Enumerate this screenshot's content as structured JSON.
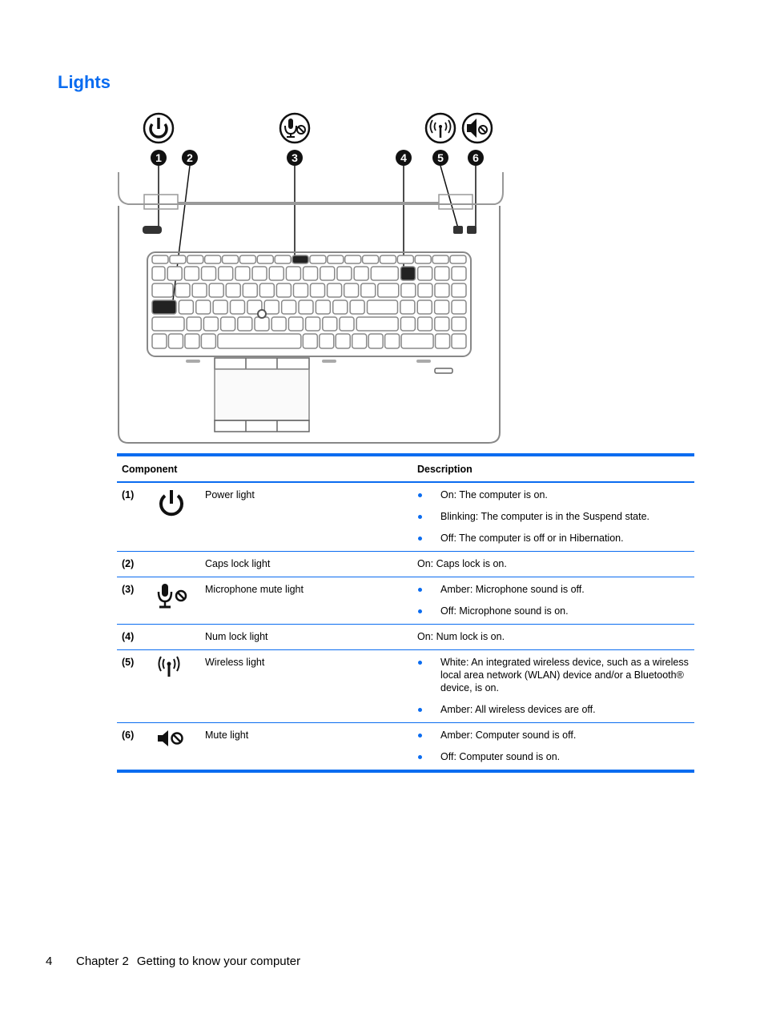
{
  "page": {
    "title": "Lights",
    "footer": {
      "page_number": "4",
      "chapter": "Chapter 2",
      "chapter_title": "Getting to know your computer"
    }
  },
  "figure": {
    "callouts": [
      {
        "number": "1",
        "icon": "power-icon"
      },
      {
        "number": "2",
        "icon": ""
      },
      {
        "number": "3",
        "icon": "microphone-mute-icon"
      },
      {
        "number": "4",
        "icon": ""
      },
      {
        "number": "5",
        "icon": "wireless-icon"
      },
      {
        "number": "6",
        "icon": "mute-icon"
      }
    ]
  },
  "table": {
    "headers": {
      "component": "Component",
      "description": "Description"
    },
    "rows": [
      {
        "id": "(1)",
        "icon": "power-icon",
        "name": "Power light",
        "bullets": [
          "On: The computer is on.",
          "Blinking: The computer is in the Suspend state.",
          "Off: The computer is off or in Hibernation."
        ]
      },
      {
        "id": "(2)",
        "icon": "",
        "name": "Caps lock light",
        "text": "On: Caps lock is on."
      },
      {
        "id": "(3)",
        "icon": "microphone-mute-icon",
        "name": "Microphone mute light",
        "bullets": [
          "Amber: Microphone sound is off.",
          "Off: Microphone sound is on."
        ]
      },
      {
        "id": "(4)",
        "icon": "",
        "name": "Num lock light",
        "text": "On: Num lock is on."
      },
      {
        "id": "(5)",
        "icon": "wireless-icon",
        "name": "Wireless light",
        "bullets": [
          "White: An integrated wireless device, such as a wireless local area network (WLAN) device and/or a Bluetooth® device, is on.",
          "Amber: All wireless devices are off."
        ]
      },
      {
        "id": "(6)",
        "icon": "mute-icon",
        "name": "Mute light",
        "bullets": [
          "Amber: Computer sound is off.",
          "Off: Computer sound is on."
        ]
      }
    ]
  },
  "colors": {
    "accent": "#0a6cf0"
  }
}
